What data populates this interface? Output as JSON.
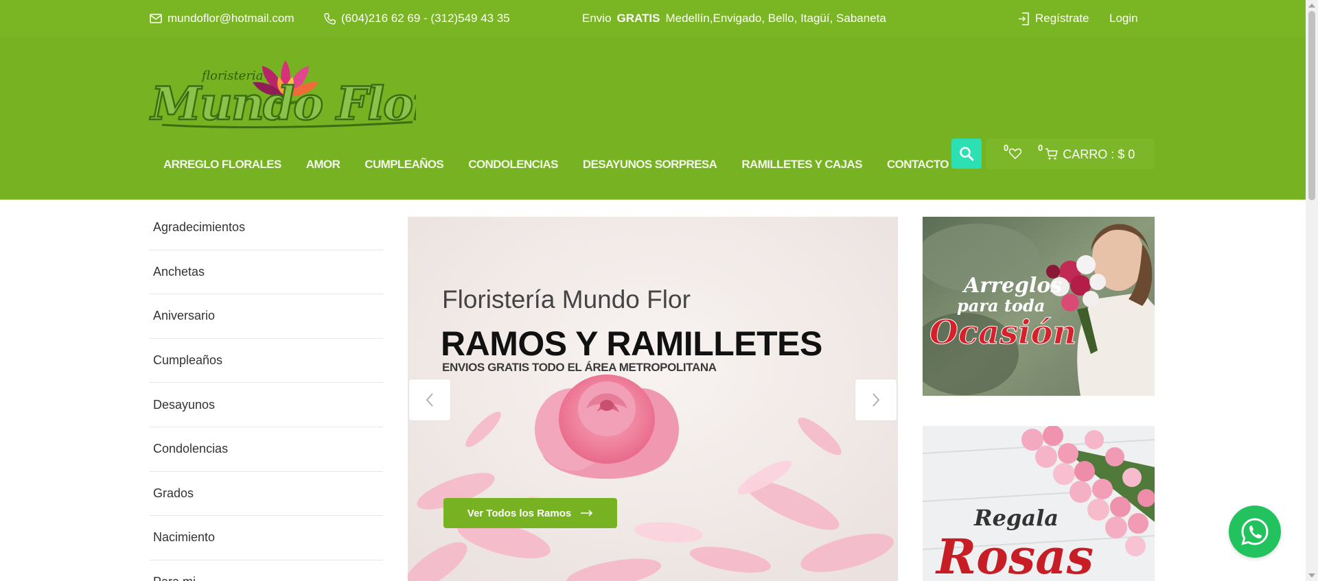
{
  "topbar": {
    "email": "mundoflor@hotmail.com",
    "phone": "(604)216 62 69 - (312)549 43 35",
    "shipping_prefix": "Envio",
    "shipping_bold": "GRATIS",
    "shipping_suffix": "Medellín,Envigado, Bello, Itagüí, Sabaneta",
    "register": "Regístrate",
    "login": "Login"
  },
  "header": {
    "logo_small": "floristeria",
    "logo_big": "Mundo Flor",
    "nav": [
      "ARREGLO FLORALES",
      "AMOR",
      "CUMPLEAÑOS",
      "CONDOLENCIAS",
      "DESAYUNOS SORPRESA",
      "RAMILLETES Y CAJAS",
      "CONTACTO"
    ],
    "wishlist_count": "0",
    "cart_count": "0",
    "cart_label": "CARRO : $ 0"
  },
  "sidebar": {
    "categories": [
      "Agradecimientos",
      "Anchetas",
      "Aniversario",
      "Cumpleaños",
      "Desayunos",
      "Condolencias",
      "Grados",
      "Nacimiento",
      "Para mi"
    ]
  },
  "slider": {
    "subtitle": "Floristería Mundo Flor",
    "title": "RAMOS Y RAMILLETES",
    "description": "ENVIOS GRATIS TODO EL ÁREA METROPOLITANA",
    "button": "Ver Todos los Ramos"
  },
  "banners": {
    "banner1_line1": "Arreglos",
    "banner1_line2": "para toda",
    "banner1_line3": "Ocasión",
    "banner2_line1": "Regala",
    "banner2_line2": "Rosas"
  },
  "colors": {
    "brand_green": "#76b221",
    "topbar_green": "#7ab524",
    "search_accent": "#2de0b4",
    "whatsapp": "#22c35e"
  },
  "icons": [
    "email-icon",
    "phone-icon",
    "login-icon",
    "search-icon",
    "heart-icon",
    "cart-icon",
    "chevron-left-icon",
    "chevron-right-icon",
    "arrow-right-icon",
    "whatsapp-icon"
  ]
}
